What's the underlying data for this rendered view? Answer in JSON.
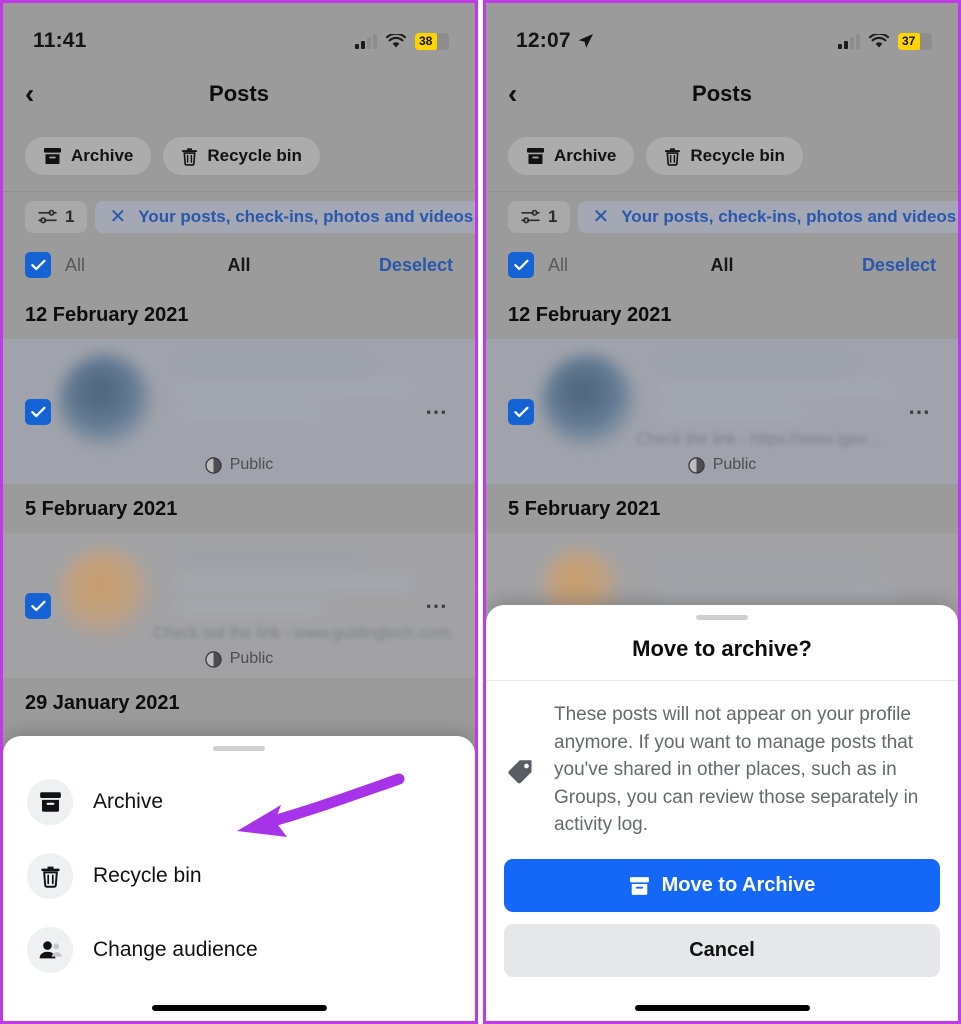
{
  "accent": {
    "annotation_purple": "#a633e8",
    "panel_border": "#c13ae8",
    "facebook_blue": "#1567f7",
    "link_blue": "#2a57ad",
    "checkbox_blue": "#1462d4",
    "battery_yellow": "#ffd400"
  },
  "left": {
    "status": {
      "time": "11:41",
      "battery": "38",
      "location_icon": "",
      "signal_icon": "cellular-bars",
      "wifi_icon": "wifi"
    },
    "nav": {
      "back_icon": "chevron-left",
      "title": "Posts"
    },
    "chips": [
      {
        "icon": "archive-icon",
        "label": "Archive"
      },
      {
        "icon": "trash-icon",
        "label": "Recycle bin"
      }
    ],
    "filter": {
      "count": "1",
      "icon": "sliders-icon",
      "clear_icon": "close-x",
      "label": "Your posts, check-ins, photos and videos"
    },
    "select_row": {
      "all_label": "All",
      "middle_label": "All",
      "deselect_label": "Deselect",
      "checked": true
    },
    "groups": [
      {
        "date": "12 February 2021",
        "posts": [
          {
            "caption": "",
            "privacy": "Public",
            "checked": true,
            "menu_icon": "more-horizontal",
            "avatar_tone": "cool"
          }
        ]
      },
      {
        "date": "5 February 2021",
        "posts": [
          {
            "caption": "Check out the link - www.guidingtech.com...",
            "privacy": "Public",
            "checked": true,
            "menu_icon": "more-horizontal",
            "avatar_tone": "warm"
          }
        ]
      },
      {
        "date": "29 January 2021",
        "posts": []
      }
    ],
    "sheet": {
      "items": [
        {
          "icon": "archive-icon",
          "label": "Archive"
        },
        {
          "icon": "trash-icon",
          "label": "Recycle bin"
        },
        {
          "icon": "audience-icon",
          "label": "Change audience"
        }
      ]
    }
  },
  "right": {
    "status": {
      "time": "12:07",
      "battery": "37",
      "location_icon": "location-arrow",
      "signal_icon": "cellular-bars",
      "wifi_icon": "wifi"
    },
    "nav": {
      "back_icon": "chevron-left",
      "title": "Posts"
    },
    "chips": [
      {
        "icon": "archive-icon",
        "label": "Archive"
      },
      {
        "icon": "trash-icon",
        "label": "Recycle bin"
      }
    ],
    "filter": {
      "count": "1",
      "icon": "sliders-icon",
      "clear_icon": "close-x",
      "label": "Your posts, check-ins, photos and videos"
    },
    "select_row": {
      "all_label": "All",
      "middle_label": "All",
      "deselect_label": "Deselect",
      "checked": true
    },
    "groups": [
      {
        "date": "12 February 2021",
        "posts": [
          {
            "caption": "Check the link - https://www.igee...",
            "privacy": "Public",
            "checked": true,
            "menu_icon": "more-horizontal",
            "avatar_tone": "cool"
          }
        ]
      },
      {
        "date": "5 February 2021",
        "posts": []
      }
    ],
    "dialog": {
      "title": "Move to archive?",
      "icon": "tag-icon",
      "body": "These posts will not appear on your profile anymore. If you want to manage posts that you've shared in other places, such as in Groups, you can review those separately in activity log.",
      "primary_button": {
        "icon": "archive-icon",
        "label": "Move to Archive"
      },
      "secondary_button": {
        "label": "Cancel"
      }
    }
  },
  "annotations": [
    {
      "name": "arrow-to-archive-option",
      "direction": "left"
    },
    {
      "name": "arrow-to-move-to-archive-button",
      "direction": "down"
    }
  ]
}
